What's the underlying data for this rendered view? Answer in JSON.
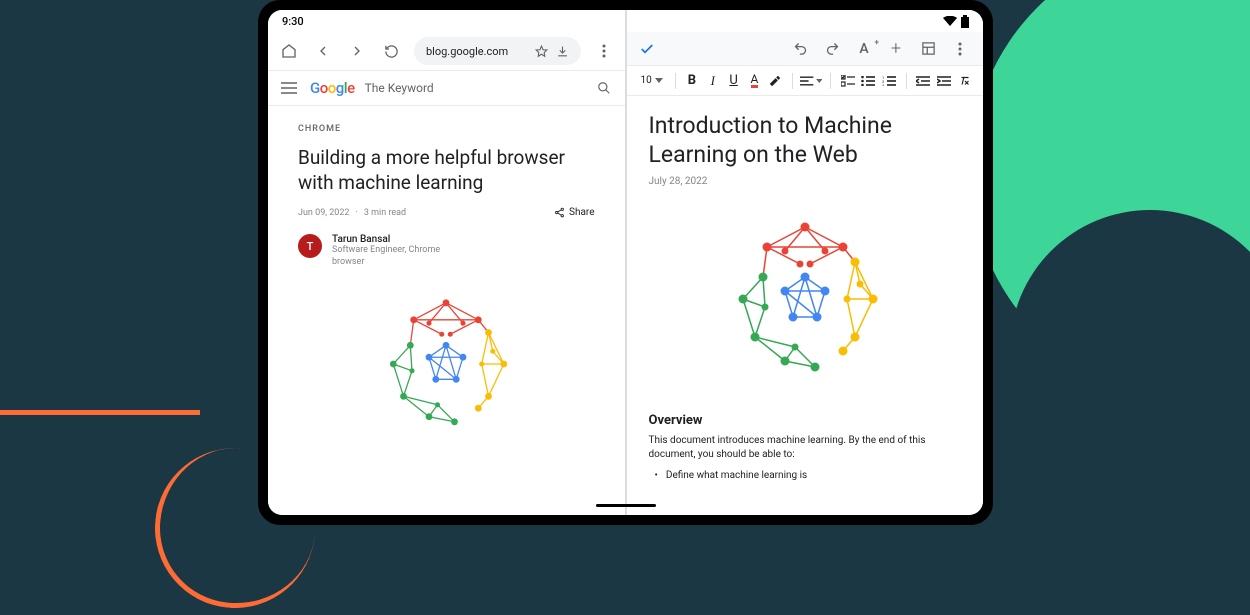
{
  "status": {
    "time": "9:30"
  },
  "chrome": {
    "url": "blog.google.com",
    "site_header": "The Keyword",
    "article": {
      "category": "CHROME",
      "headline": "Building a more helpful browser with machine learning",
      "date": "Jun 09, 2022",
      "read_time": "3 min read",
      "share_label": "Share",
      "author_initial": "T",
      "author_name": "Tarun Bansal",
      "author_title": "Software Engineer, Chrome browser"
    }
  },
  "docs": {
    "font_size": "10",
    "title": "Introduction to Machine Learning on the Web",
    "date": "July 28, 2022",
    "section_heading": "Overview",
    "intro": "This document introduces machine learning. By the end of this document, you should be able to:",
    "bullet1": "Define what machine learning is"
  }
}
